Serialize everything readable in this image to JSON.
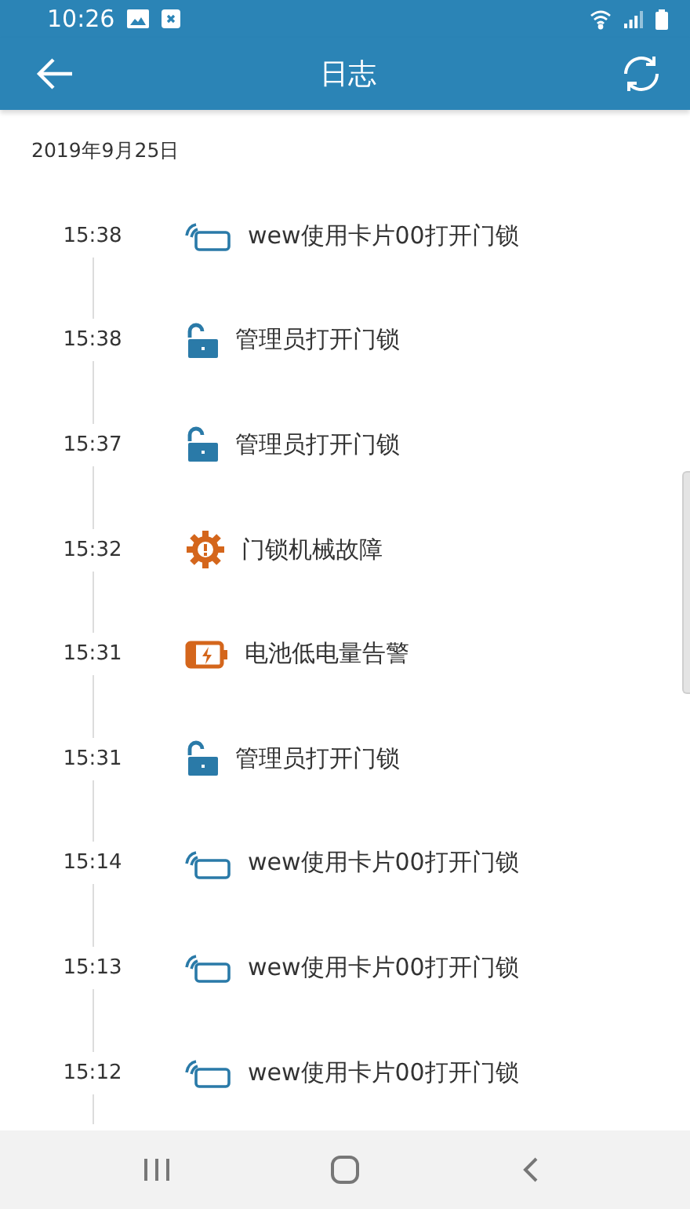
{
  "status_bar": {
    "time": "10:26"
  },
  "app_bar": {
    "title": "日志"
  },
  "date": "2019年9月25日",
  "entries": [
    {
      "time": "15:38",
      "kind": "card",
      "text": "wew使用卡片00打开门锁"
    },
    {
      "time": "15:38",
      "kind": "unlock",
      "text": "管理员打开门锁"
    },
    {
      "time": "15:37",
      "kind": "unlock",
      "text": "管理员打开门锁"
    },
    {
      "time": "15:32",
      "kind": "fault",
      "text": "门锁机械故障"
    },
    {
      "time": "15:31",
      "kind": "battery",
      "text": "电池低电量告警"
    },
    {
      "time": "15:31",
      "kind": "unlock",
      "text": "管理员打开门锁"
    },
    {
      "time": "15:14",
      "kind": "card",
      "text": "wew使用卡片00打开门锁"
    },
    {
      "time": "15:13",
      "kind": "card",
      "text": "wew使用卡片00打开门锁"
    },
    {
      "time": "15:12",
      "kind": "card",
      "text": "wew使用卡片00打开门锁"
    }
  ]
}
